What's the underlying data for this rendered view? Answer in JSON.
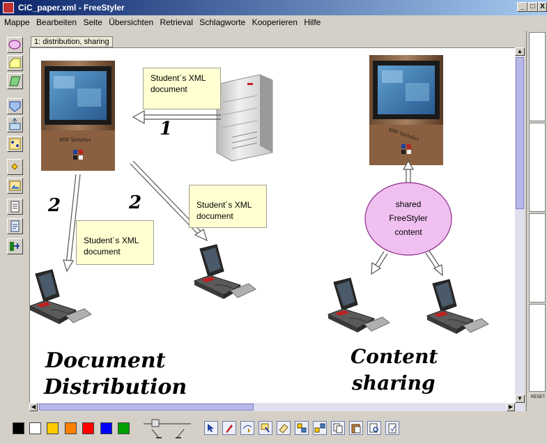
{
  "window": {
    "title": "CiC_paper.xml - FreeStyler",
    "min": "_",
    "max": "□",
    "close": "X"
  },
  "menu": [
    "Mappe",
    "Bearbeiten",
    "Seite",
    "Übersichten",
    "Retrieval",
    "Schlagworte",
    "Kooperieren",
    "Hilfe"
  ],
  "page_tab": "1: distribution, sharing",
  "canvas": {
    "notes": [
      {
        "line1": "Student´s XML",
        "line2": "document"
      },
      {
        "line1": "Student´s XML",
        "line2": "document"
      },
      {
        "line1": "Student´s XML",
        "line2": "document"
      }
    ],
    "ellipse": {
      "line1": "shared",
      "line2": "FreeStyler",
      "line3": "content"
    },
    "monitor_brand": "MW Variolux",
    "ink": {
      "num1": "1",
      "num2a": "2",
      "num2b": "2",
      "left_title_1": "Document",
      "left_title_2": "Distribution",
      "right_title_1": "Content",
      "right_title_2": "sharing"
    }
  },
  "right_panel": {
    "reset_label": "RESET"
  },
  "colors": {
    "palette": [
      "#000000",
      "#ffffff",
      "#ffcc00",
      "#ff8000",
      "#ff0000",
      "#0000ff",
      "#00a000"
    ],
    "ellipse_fill": "#f0c0f0",
    "note_fill": "#ffffd2",
    "title_bar": "#0a246a"
  }
}
